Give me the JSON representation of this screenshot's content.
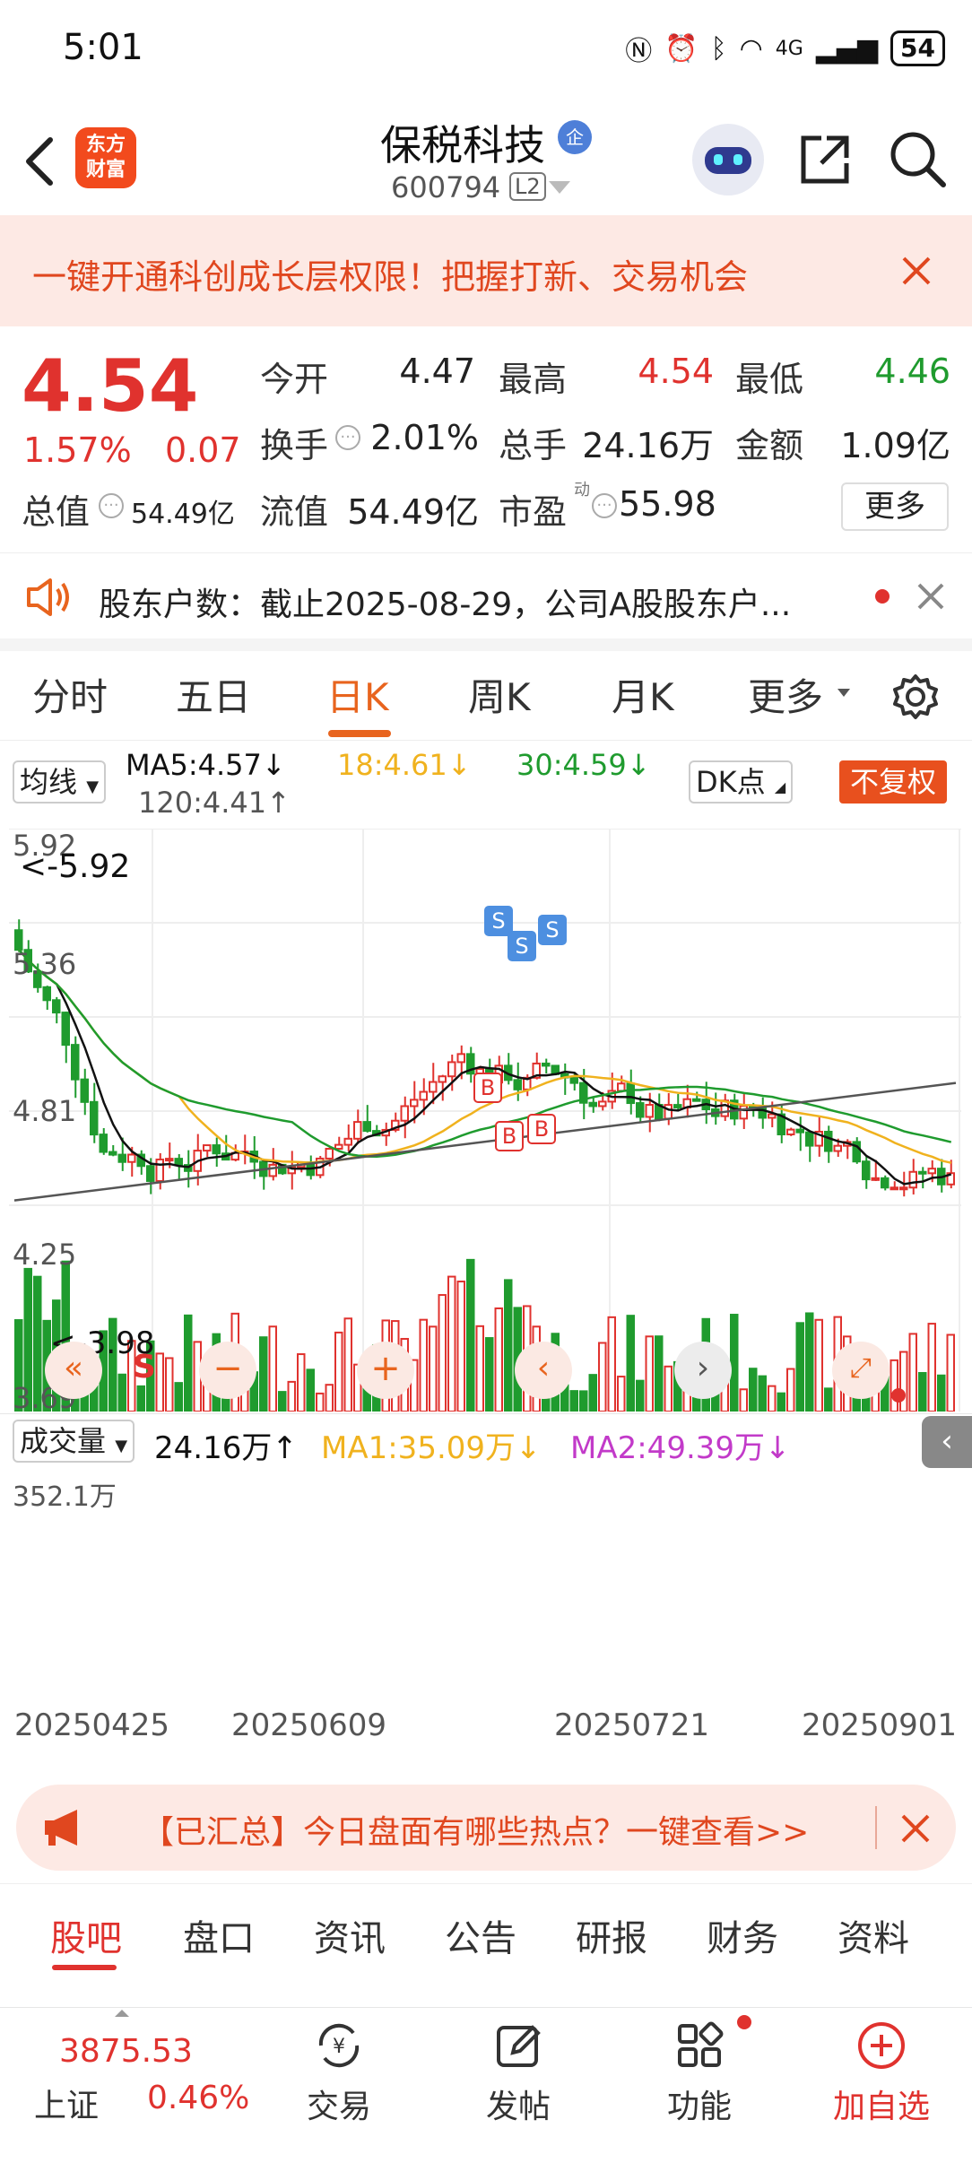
{
  "status_bar": {
    "time": "5:01",
    "network": "4G",
    "battery": "54"
  },
  "header": {
    "logo_text": "东方财富",
    "stock_name": "保税科技",
    "badge": "企",
    "code": "600794",
    "level": "L2"
  },
  "banner": {
    "text": "一键开通科创成长层权限！把握打新、交易机会"
  },
  "quote": {
    "price": "4.54",
    "change_pct": "1.57%",
    "change": "0.07",
    "rows": [
      [
        {
          "label": "今开",
          "value": "4.47",
          "color": "dark"
        },
        {
          "label": "最高",
          "value": "4.54",
          "color": "red"
        },
        {
          "label": "最低",
          "value": "4.46",
          "color": "green"
        }
      ],
      [
        {
          "label": "换手",
          "value": "2.01%",
          "color": "dark"
        },
        {
          "label": "总手",
          "value": "24.16万",
          "color": "dark"
        },
        {
          "label": "金额",
          "value": "1.09亿",
          "color": "dark"
        }
      ],
      [
        {
          "label": "流值",
          "value": "54.49亿",
          "color": "dark"
        },
        {
          "label": "市盈",
          "value": "55.98",
          "color": "dark"
        }
      ]
    ],
    "total_value_label": "总值",
    "total_value": "54.49亿",
    "pe_sup": "动",
    "more_label": "更多"
  },
  "notice": {
    "text": "股东户数：截止2025-08-29，公司A股股东户..."
  },
  "tabs": [
    "分时",
    "五日",
    "日K",
    "周K",
    "月K",
    "更多"
  ],
  "active_tab": "日K",
  "ma": {
    "select": "均线",
    "ma5": "MA5:4.57",
    "ma18": "18:4.61",
    "ma30": "30:4.59",
    "ma120": "120:4.41",
    "dk_label": "DK点",
    "adjust": "不复权"
  },
  "kline": {
    "y_labels": [
      "5.92",
      "5.36",
      "4.81",
      "4.25",
      "3.69"
    ],
    "max_label": "<-5.92",
    "min_label": "<-3.98",
    "signals": [
      "S",
      "S",
      "S",
      "B",
      "B",
      "B"
    ],
    "s_marker": "S",
    "colors": {
      "up": "#e0322e",
      "down": "#1f9b2e",
      "ma5": "#111111",
      "ma18": "#f0b21e",
      "ma30": "#1f9b2e",
      "ma120": "#555555"
    }
  },
  "volume": {
    "select": "成交量",
    "value": "24.16万",
    "ma1": "MA1:35.09万",
    "ma2": "MA2:49.39万",
    "max_label": "352.1万"
  },
  "x_dates": [
    "20250425",
    "20250609",
    "20250721",
    "20250901"
  ],
  "promo": {
    "text": "【已汇总】今日盘面有哪些热点？一键查看>>"
  },
  "sub_tabs": [
    "股吧",
    "盘口",
    "资讯",
    "公告",
    "研报",
    "财务",
    "资料"
  ],
  "bottom_nav": {
    "index_value": "3875.53",
    "index_name": "上证",
    "index_change": "0.46%",
    "items": [
      "交易",
      "发帖",
      "功能",
      "加自选"
    ]
  }
}
